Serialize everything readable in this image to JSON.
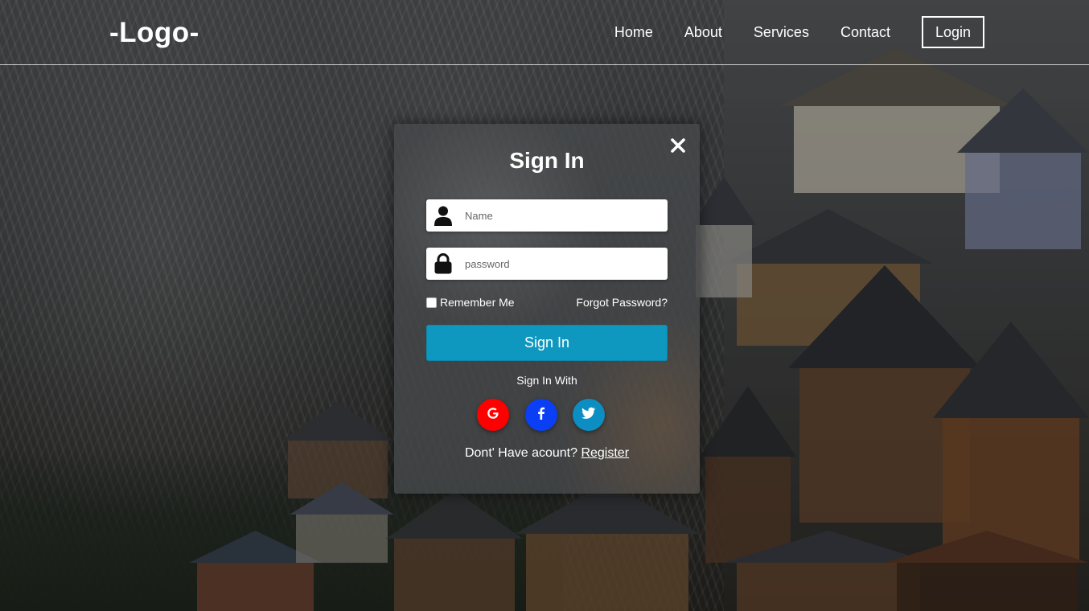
{
  "header": {
    "logo": "-Logo-",
    "nav": [
      {
        "label": "Home"
      },
      {
        "label": "About"
      },
      {
        "label": "Services"
      },
      {
        "label": "Contact"
      }
    ],
    "login_label": "Login"
  },
  "modal": {
    "title": "Sign In",
    "close_icon": "close-icon",
    "name_field": {
      "placeholder": "Name",
      "value": "",
      "icon": "user-icon"
    },
    "password_field": {
      "placeholder": "password",
      "value": "",
      "icon": "lock-icon"
    },
    "remember_label": "Remember Me",
    "remember_checked": false,
    "forgot_label": "Forgot Password?",
    "submit_label": "Sign In",
    "sign_in_with_label": "Sign In With",
    "socials": [
      {
        "icon": "google-icon",
        "color": "#ff0000"
      },
      {
        "icon": "facebook-icon",
        "color": "#0a3ff5"
      },
      {
        "icon": "twitter-icon",
        "color": "#0c8ec2"
      }
    ],
    "register_prompt": "Dont' Have acount?",
    "register_label": "Register",
    "accent_color": "#0e98bf"
  }
}
